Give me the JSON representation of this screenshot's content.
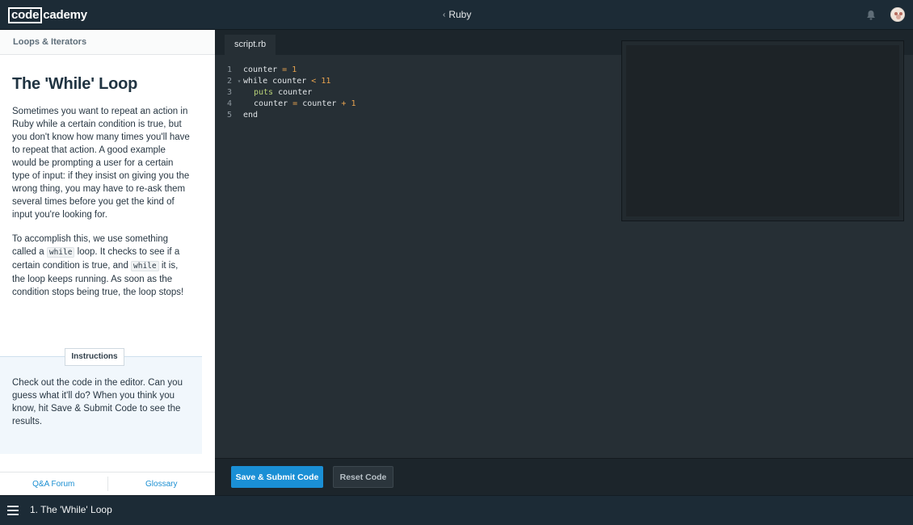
{
  "header": {
    "logo_box": "code",
    "logo_rest": "cademy",
    "course_label": "Ruby"
  },
  "lesson": {
    "section": "Loops & Iterators",
    "title": "The 'While' Loop",
    "para1": "Sometimes you want to repeat an action in Ruby while a certain condition is true, but you don't know how many times you'll have to repeat that action. A good example would be prompting a user for a certain type of input: if they insist on giving you the wrong thing, you may have to re-ask them several times before you get the kind of input you're looking for.",
    "para2_a": "To accomplish this, we use something called a ",
    "para2_code1": "while",
    "para2_b": " loop. It checks to see if a certain condition is true, and ",
    "para2_code2": "while",
    "para2_c": " it is, the loop keeps running. As soon as the condition stops being true, the loop stops!",
    "instructions_label": "Instructions",
    "instructions_text": "Check out the code in the editor. Can you guess what it'll do? When you think you know, hit Save & Submit Code to see the results.",
    "footer_links": [
      "Q&A Forum",
      "Glossary"
    ]
  },
  "editor": {
    "tab": "script.rb",
    "line_numbers": [
      "1",
      "2",
      "3",
      "4",
      "5"
    ],
    "lines": {
      "l1_a": "counter",
      "l1_op": " = ",
      "l1_num": "1",
      "l2_kw": "while",
      "l2_a": " counter ",
      "l2_op": "<",
      "l2_num": " 11",
      "l3_method": "puts",
      "l3_a": " counter",
      "l4_a": "counter",
      "l4_op1": " = ",
      "l4_b": "counter ",
      "l4_op2": "+",
      "l4_num": " 1",
      "l5_kw": "end"
    }
  },
  "actions": {
    "submit": "Save & Submit Code",
    "reset": "Reset Code"
  },
  "footer": {
    "title": "1. The 'While' Loop"
  }
}
